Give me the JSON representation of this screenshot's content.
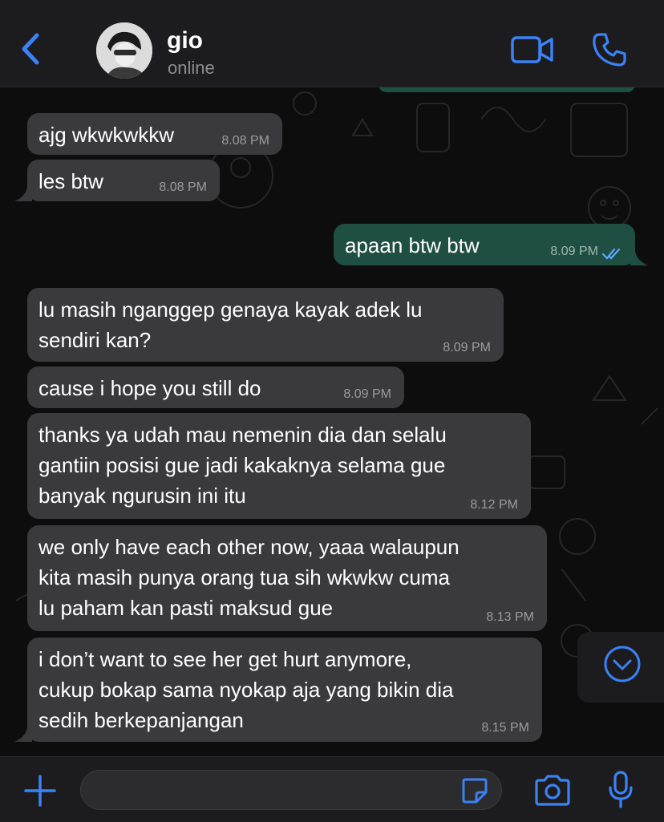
{
  "colors": {
    "accent": "#3b82f6",
    "incoming_bubble": "#3a3a3c",
    "outgoing_bubble": "#1f4e43",
    "header_bg": "#1c1c1e"
  },
  "header": {
    "back_icon": "chevron-left-icon",
    "contact_name": "gio",
    "contact_status": "online",
    "video_icon": "video-camera-icon",
    "call_icon": "phone-icon"
  },
  "messages": [
    {
      "direction": "in",
      "text": "ajg wkwkwkkw",
      "time": "8.08 PM"
    },
    {
      "direction": "in",
      "text": "les btw",
      "time": "8.08 PM"
    },
    {
      "direction": "out",
      "text": "apaan btw btw",
      "time": "8.09 PM",
      "status": "read"
    },
    {
      "direction": "in",
      "text": "lu masih nganggep genaya kayak adek lu\nsendiri kan?",
      "time": "8.09 PM"
    },
    {
      "direction": "in",
      "text": "cause i hope you still do",
      "time": "8.09 PM"
    },
    {
      "direction": "in",
      "text": "thanks ya udah mau nemenin dia dan selalu\ngantiin posisi gue jadi kakaknya selama gue\nbanyak ngurusin ini itu",
      "time": "8.12 PM"
    },
    {
      "direction": "in",
      "text": "we only have each other now, yaaa walaupun\nkita masih punya orang tua sih wkwkw cuma\nlu paham kan pasti maksud gue",
      "time": "8.13 PM"
    },
    {
      "direction": "in",
      "text": "i don’t want to see her get hurt anymore,\ncukup bokap sama nyokap aja yang bikin dia\nsedih berkepanjangan",
      "time": "8.15 PM"
    }
  ],
  "scroll_down_icon": "chevron-down-circle-icon",
  "input_bar": {
    "plus_icon": "plus-icon",
    "input_value": "",
    "sticker_icon": "sticker-icon",
    "camera_icon": "camera-icon",
    "mic_icon": "microphone-icon"
  }
}
